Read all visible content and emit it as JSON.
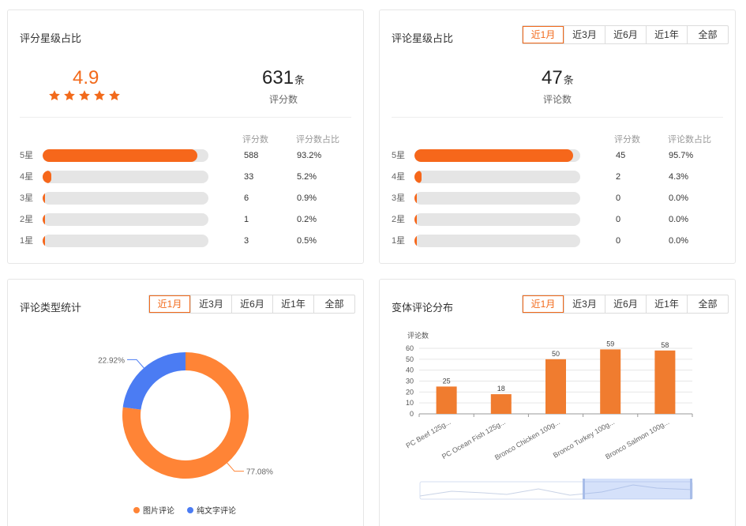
{
  "rating_card": {
    "title": "评分星级占比",
    "score": "4.9",
    "star_count": 5,
    "total_value": "631",
    "total_unit": "条",
    "total_label": "评分数",
    "col_count": "评分数",
    "col_pct": "评分数占比",
    "rows": [
      {
        "label": "5星",
        "count": "588",
        "pct": "93.2%",
        "fraction": 0.932
      },
      {
        "label": "4星",
        "count": "33",
        "pct": "5.2%",
        "fraction": 0.052
      },
      {
        "label": "3星",
        "count": "6",
        "pct": "0.9%",
        "fraction": 0.009
      },
      {
        "label": "2星",
        "count": "1",
        "pct": "0.2%",
        "fraction": 0.002
      },
      {
        "label": "1星",
        "count": "3",
        "pct": "0.5%",
        "fraction": 0.005
      }
    ]
  },
  "review_card": {
    "title": "评论星级占比",
    "tabs": [
      "近1月",
      "近3月",
      "近6月",
      "近1年",
      "全部"
    ],
    "active_tab": 0,
    "total_value": "47",
    "total_unit": "条",
    "total_label": "评论数",
    "col_count": "评分数",
    "col_pct": "评论数占比",
    "rows": [
      {
        "label": "5星",
        "count": "45",
        "pct": "95.7%",
        "fraction": 0.957
      },
      {
        "label": "4星",
        "count": "2",
        "pct": "4.3%",
        "fraction": 0.043
      },
      {
        "label": "3星",
        "count": "0",
        "pct": "0.0%",
        "fraction": 0
      },
      {
        "label": "2星",
        "count": "0",
        "pct": "0.0%",
        "fraction": 0
      },
      {
        "label": "1星",
        "count": "0",
        "pct": "0.0%",
        "fraction": 0
      }
    ]
  },
  "type_card": {
    "title": "评论类型统计",
    "tabs": [
      "近1月",
      "近3月",
      "近6月",
      "近1年",
      "全部"
    ],
    "active_tab": 0
  },
  "variant_card": {
    "title": "变体评论分布",
    "tabs": [
      "近1月",
      "近3月",
      "近6月",
      "近1年",
      "全部"
    ],
    "active_tab": 0
  },
  "colors": {
    "accent": "#f26a1b",
    "bar_fill": "#f6671b",
    "donut_orange": "#ff8436",
    "donut_blue": "#4b7cf3",
    "column": "#f07c2f"
  },
  "chart_data": [
    {
      "type": "pie",
      "style": "donut",
      "labels": [
        "图片评论",
        "纯文字评论"
      ],
      "values": [
        77.08,
        22.92
      ],
      "value_labels": [
        "77.08%",
        "22.92%"
      ],
      "colors": [
        "#ff8436",
        "#4b7cf3"
      ],
      "legend": "bottom-center"
    },
    {
      "type": "bar",
      "ylabel": "评论数",
      "categories": [
        "PC Beef 125g...",
        "PC Ocean Fish 125g...",
        "Bronco Chicken 100g...",
        "Bronco Turkey 100g...",
        "Bronco Salmon 100g..."
      ],
      "values": [
        25,
        18,
        50,
        59,
        58
      ],
      "ylim": [
        0,
        60
      ],
      "yticks": [
        0,
        10,
        20,
        30,
        40,
        50,
        60
      ],
      "grid": true,
      "data_zoom": true
    }
  ]
}
